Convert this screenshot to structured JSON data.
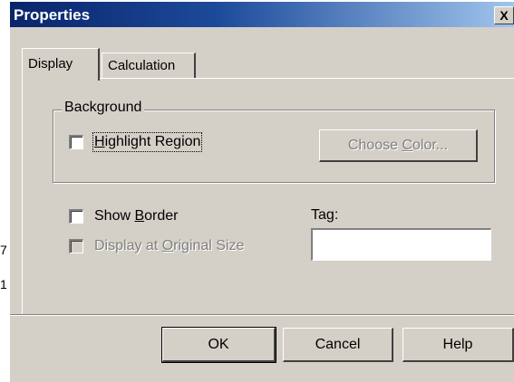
{
  "window": {
    "title": "Properties",
    "close_glyph": "X"
  },
  "tabs": [
    {
      "label": "Display",
      "active": true
    },
    {
      "label": "Calculation",
      "active": false
    }
  ],
  "background_group": {
    "legend": "Background",
    "highlight_region": {
      "pre": "",
      "accel": "H",
      "post": "ighlight Region",
      "checked": false
    },
    "choose_color": {
      "pre": "Choose ",
      "accel": "C",
      "post": "olor...",
      "enabled": false
    }
  },
  "show_border": {
    "pre": "Show ",
    "accel": "B",
    "post": "order",
    "checked": false
  },
  "display_original": {
    "pre": "Display at ",
    "accel": "O",
    "post": "riginal Size",
    "checked": false,
    "enabled": false
  },
  "tag": {
    "pre": "Ta",
    "accel": "g",
    "post": ":",
    "value": ""
  },
  "buttons": {
    "ok": "OK",
    "cancel": "Cancel",
    "help": "Help"
  },
  "stray_marks": {
    "left_top": "7",
    "left_bottom": "1"
  }
}
